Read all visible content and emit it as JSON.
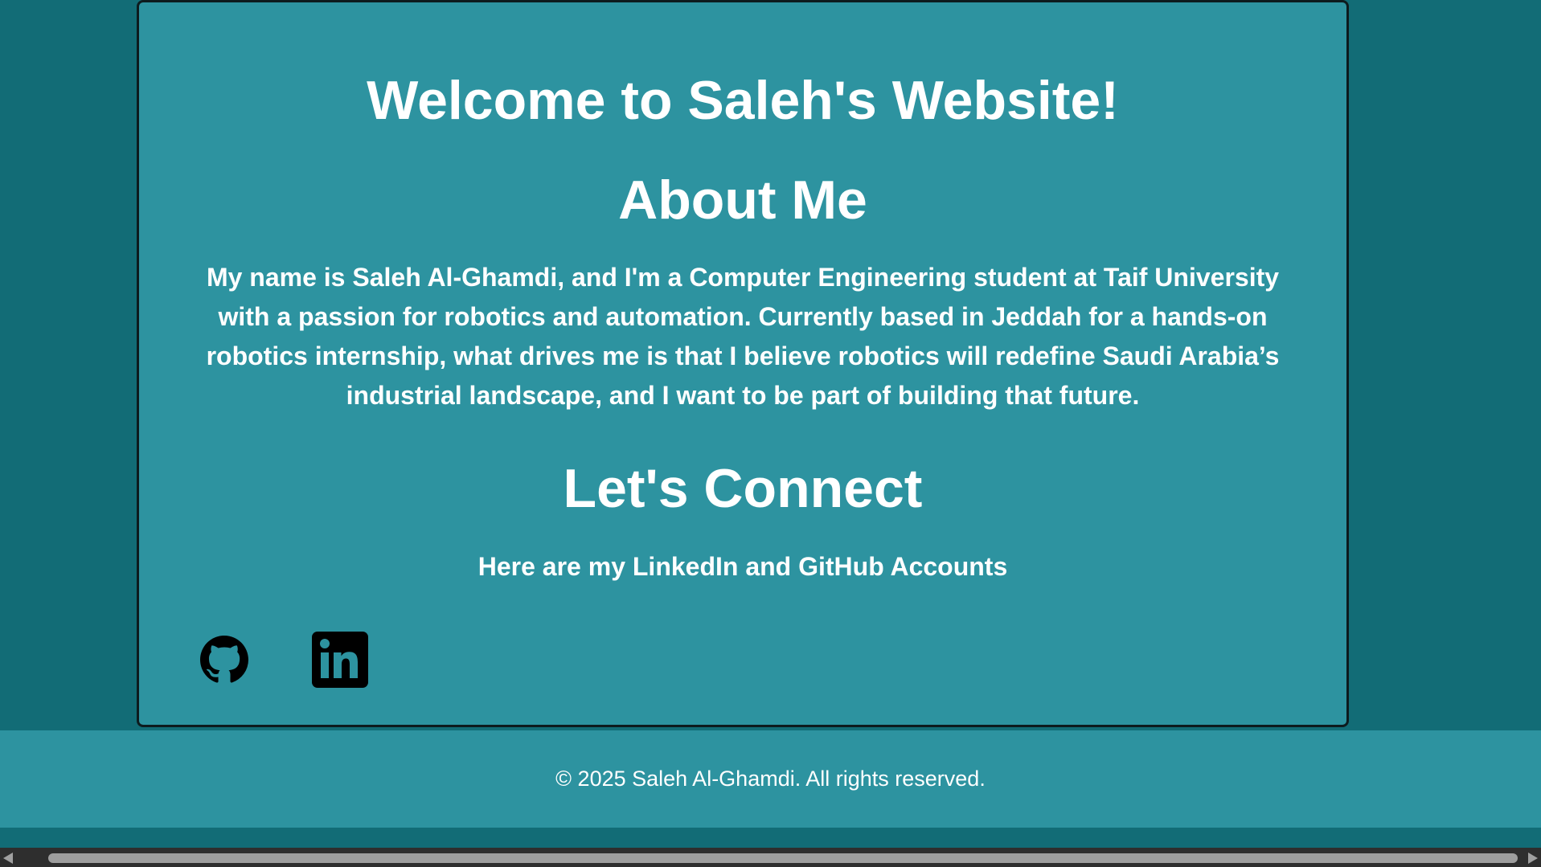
{
  "main": {
    "title": "Welcome to Saleh's Website!",
    "about_heading": "About Me",
    "about_text": "My name is Saleh Al-Ghamdi, and I'm a Computer Engineering student at Taif University with a passion for robotics and automation. Currently based in Jeddah for a hands-on robotics internship, what drives me is that I believe robotics will redefine Saudi Arabia’s industrial landscape, and I want to be part of building that future.",
    "connect_heading": "Let's Connect",
    "connect_sub": "Here are my LinkedIn and GitHub Accounts",
    "social": [
      {
        "icon": "github-icon"
      },
      {
        "icon": "linkedin-icon"
      }
    ]
  },
  "footer": {
    "text": "© 2025 Saleh Al-Ghamdi. All rights reserved."
  },
  "colors": {
    "page_background": "#126c76",
    "card_background": "#2d93a0",
    "card_border": "#0d1b1e",
    "text": "#ffffff",
    "icon": "#000000"
  }
}
